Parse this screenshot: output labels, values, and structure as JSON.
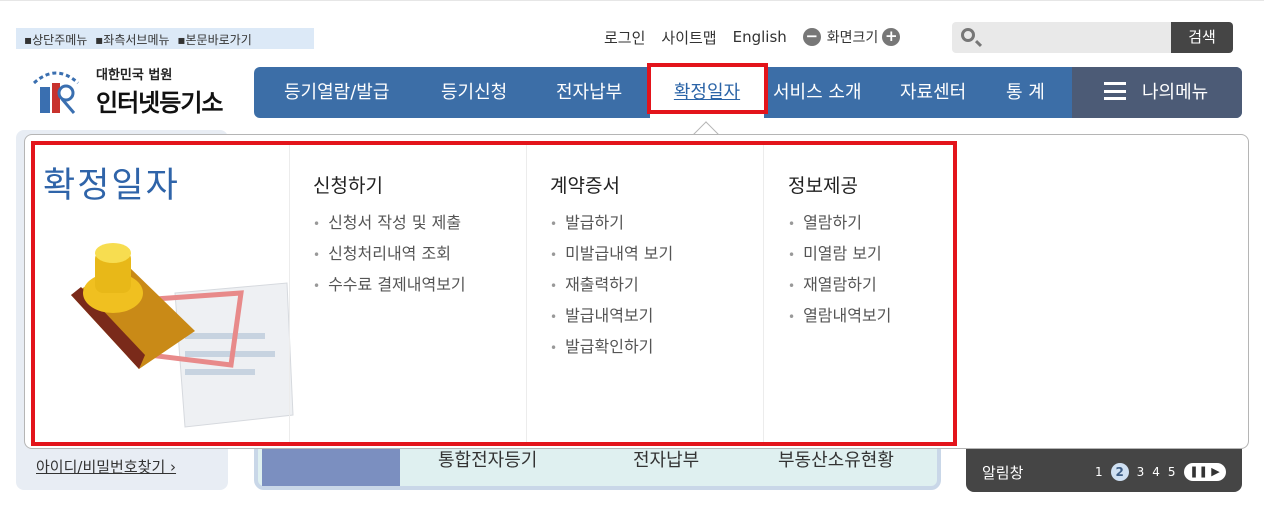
{
  "skip_links": [
    "▪상단주메뉴",
    "▪좌측서브메뉴",
    "▪본문바로가기"
  ],
  "top_links": {
    "login": "로그인",
    "sitemap": "사이트맵",
    "english": "English",
    "zoom_label": "화면크기",
    "zoom_out": "−",
    "zoom_in": "+"
  },
  "search": {
    "placeholder": "",
    "button": "검색"
  },
  "logo": {
    "line1": "대한민국 법원",
    "line2": "인터넷등기소",
    "emblem": "court-emblem"
  },
  "nav": {
    "items": [
      "등기열람/발급",
      "등기신청",
      "전자납부",
      "확정일자",
      "서비스 소개",
      "자료센터",
      "통 계"
    ],
    "active": "확정일자",
    "my_menu": "나의메뉴"
  },
  "dropdown": {
    "title": "확정일자",
    "columns": [
      {
        "title": "신청하기",
        "items": [
          "신청서 작성 및 제출",
          "신청처리내역 조회",
          "수수료 결제내역보기"
        ]
      },
      {
        "title": "계약증서",
        "items": [
          "발급하기",
          "미발급내역 보기",
          "재출력하기",
          "발급내역보기",
          "발급확인하기"
        ]
      },
      {
        "title": "정보제공",
        "items": [
          "열람하기",
          "미열람 보기",
          "재열람하기",
          "열람내역보기"
        ]
      }
    ]
  },
  "background": {
    "find_id": "아이디/비밀번호찾기 ›",
    "quick_links": [
      "통합전자등기",
      "전자납부",
      "부동산소유현황"
    ],
    "notice_label": "알림창",
    "pages": [
      "1",
      "2",
      "3",
      "4",
      "5"
    ],
    "active_page": "2"
  },
  "colors": {
    "nav": "#3c6ea7",
    "my_menu": "#4c5b76",
    "highlight": "#e3141b",
    "title": "#2f64a9"
  }
}
